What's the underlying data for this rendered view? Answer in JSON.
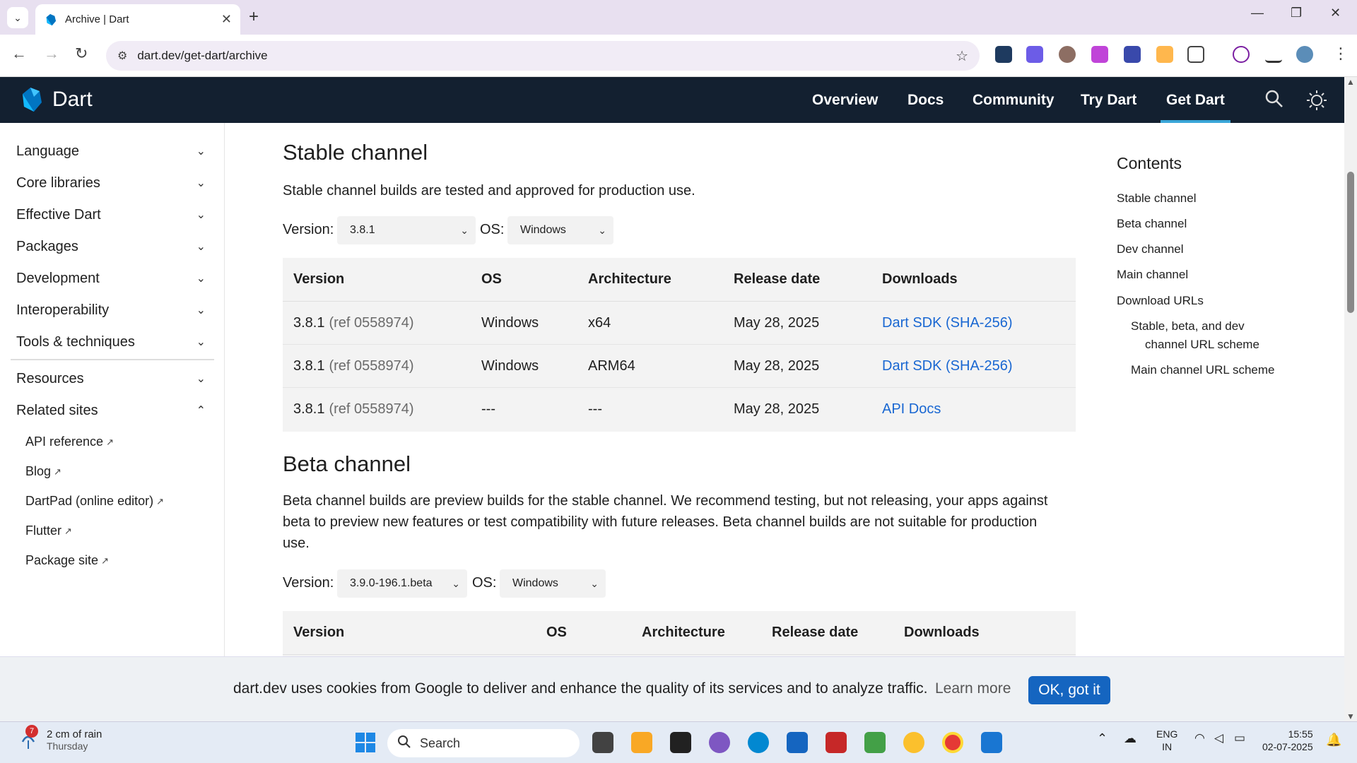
{
  "browser": {
    "tab_title": "Archive | Dart",
    "url": "dart.dev/get-dart/archive",
    "new_tab": "+",
    "close_tab": "✕"
  },
  "header": {
    "site_name": "Dart",
    "nav": [
      "Overview",
      "Docs",
      "Community",
      "Try Dart",
      "Get Dart"
    ],
    "active_nav": "Get Dart"
  },
  "sidebar": {
    "items": [
      "Language",
      "Core libraries",
      "Effective Dart",
      "Packages",
      "Development",
      "Interoperability",
      "Tools & techniques"
    ],
    "resources": "Resources",
    "related": "Related sites",
    "related_links": [
      "API reference",
      "Blog",
      "DartPad (online editor)",
      "Flutter",
      "Package site"
    ]
  },
  "stable": {
    "heading": "Stable channel",
    "description": "Stable channel builds are tested and approved for production use.",
    "version_label": "Version:",
    "version_value": "3.8.1",
    "os_label": "OS:",
    "os_value": "Windows",
    "columns": [
      "Version",
      "OS",
      "Architecture",
      "Release date",
      "Downloads"
    ],
    "rows": [
      {
        "version": "3.8.1",
        "ref": "(ref 0558974)",
        "os": "Windows",
        "arch": "x64",
        "date": "May 28, 2025",
        "download": "Dart SDK (SHA-256)"
      },
      {
        "version": "3.8.1",
        "ref": "(ref 0558974)",
        "os": "Windows",
        "arch": "ARM64",
        "date": "May 28, 2025",
        "download": "Dart SDK (SHA-256)"
      },
      {
        "version": "3.8.1",
        "ref": "(ref 0558974)",
        "os": "---",
        "arch": "---",
        "date": "May 28, 2025",
        "download": "API Docs"
      }
    ]
  },
  "beta": {
    "heading": "Beta channel",
    "description_1": "Beta channel builds are preview builds for the stable channel. We recommend testing, but not releasing, your apps against",
    "description_2": "beta to preview new features or test compatibility with future releases. Beta channel builds are not suitable for production",
    "description_3": "use.",
    "version_label": "Version:",
    "version_value": "3.9.0-196.1.beta",
    "os_label": "OS:",
    "os_value": "Windows",
    "columns": [
      "Version",
      "OS",
      "Architecture",
      "Release date",
      "Downloads"
    ]
  },
  "toc": {
    "title": "Contents",
    "items": [
      "Stable channel",
      "Beta channel",
      "Dev channel",
      "Main channel",
      "Download URLs"
    ],
    "sub_items": [
      "Stable, beta, and dev",
      "channel URL scheme",
      "Main channel URL scheme"
    ]
  },
  "cookie": {
    "message": "dart.dev uses cookies from Google to deliver and enhance the quality of its services and to analyze traffic.",
    "learn_more": "Learn more",
    "ok": "OK, got it"
  },
  "taskbar": {
    "weather_badge": "7",
    "weather_line1": "2 cm of rain",
    "weather_line2": "Thursday",
    "search_placeholder": "Search",
    "lang_1": "ENG",
    "lang_2": "IN",
    "time": "15:55",
    "date": "02-07-2025"
  },
  "colors": {
    "dart_header": "#132030",
    "link": "#1967d2",
    "accent": "#3aa6d8",
    "ok_button": "#1565c0"
  }
}
